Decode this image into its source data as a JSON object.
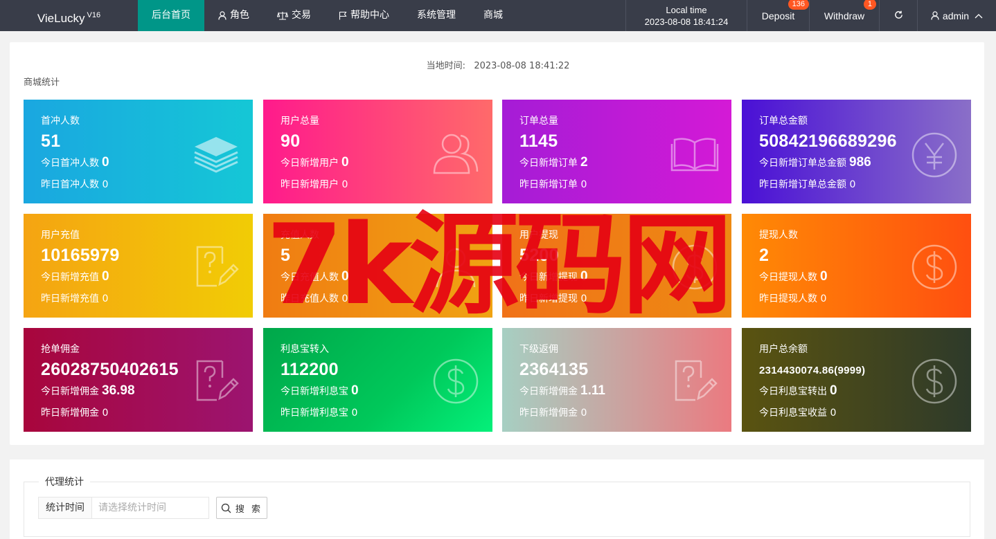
{
  "header": {
    "logo": "VieLucky",
    "logo_version": "V16",
    "nav": [
      {
        "label": "后台首页",
        "icon": "",
        "active": true
      },
      {
        "label": "角色",
        "icon": "user-icon"
      },
      {
        "label": "交易",
        "icon": "scale-icon"
      },
      {
        "label": "帮助中心",
        "icon": "flag-icon"
      },
      {
        "label": "系统管理",
        "icon": ""
      },
      {
        "label": "商城",
        "icon": ""
      }
    ],
    "local_time_label": "Local time",
    "local_time_value": "2023-08-08 18:41:24",
    "deposit_label": "Deposit",
    "deposit_badge": "136",
    "withdraw_label": "Withdraw",
    "withdraw_badge": "1",
    "user_label": "admin"
  },
  "dashboard": {
    "local_time_label": "当地时间:",
    "local_time_value": "2023-08-08 18:41:22",
    "section_title": "商城统计",
    "cards": [
      {
        "label": "首冲人数",
        "value": "51",
        "today_label": "今日首冲人数",
        "today_value": "0",
        "yesterday_label": "昨日首冲人数",
        "yesterday_value": "0",
        "icon": "layers-icon"
      },
      {
        "label": "用户总量",
        "value": "90",
        "today_label": "今日新增用户",
        "today_value": "0",
        "yesterday_label": "昨日新增用户",
        "yesterday_value": "0",
        "icon": "users-icon"
      },
      {
        "label": "订单总量",
        "value": "1145",
        "today_label": "今日新增订单",
        "today_value": "2",
        "yesterday_label": "昨日新增订单",
        "yesterday_value": "0",
        "icon": "book-icon"
      },
      {
        "label": "订单总金额",
        "value": "50842196689296",
        "today_label": "今日新增订单总金额",
        "today_value": "986",
        "yesterday_label": "昨日新增订单总金额",
        "yesterday_value": "0",
        "icon": "yen-icon"
      },
      {
        "label": "用户充值",
        "value": "10165979",
        "today_label": "今日新增充值",
        "today_value": "0",
        "yesterday_label": "昨日新增充值",
        "yesterday_value": "0",
        "icon": "edit-question-icon"
      },
      {
        "label": "充值人数",
        "value": "5",
        "today_label": "今日充值人数",
        "today_value": "0",
        "yesterday_label": "昨日充值人数",
        "yesterday_value": "0",
        "icon": "user-icon"
      },
      {
        "label": "用户提现",
        "value": "5200",
        "today_label": "今日新增提现",
        "today_value": "0",
        "yesterday_label": "昨日新增提现",
        "yesterday_value": "0",
        "icon": "dollar-icon"
      },
      {
        "label": "提现人数",
        "value": "2",
        "today_label": "今日提现人数",
        "today_value": "0",
        "yesterday_label": "昨日提现人数",
        "yesterday_value": "0",
        "icon": "dollar-icon"
      },
      {
        "label": "抢单佣金",
        "value": "26028750402615",
        "today_label": "今日新增佣金",
        "today_value": "36.98",
        "yesterday_label": "昨日新增佣金",
        "yesterday_value": "0",
        "icon": "edit-question-icon"
      },
      {
        "label": "利息宝转入",
        "value": "112200",
        "today_label": "今日新增利息宝",
        "today_value": "0",
        "yesterday_label": "昨日新增利息宝",
        "yesterday_value": "0",
        "icon": "dollar-icon"
      },
      {
        "label": "下级返佣",
        "value": "2364135",
        "today_label": "今日新增佣金",
        "today_value": "1.11",
        "yesterday_label": "昨日新增佣金",
        "yesterday_value": "0",
        "icon": "edit-question-icon"
      },
      {
        "label": "用户总余额",
        "value": "2314430074.86(9999)",
        "today_label": "今日利息宝转出",
        "today_value": "0",
        "yesterday_label": "今日利息宝收益",
        "yesterday_value": "0",
        "icon": "dollar-icon"
      }
    ],
    "watermark": "7k源码网"
  },
  "agent": {
    "legend": "代理统计",
    "time_label": "统计时间",
    "time_placeholder": "请选择统计时间",
    "search_label": "搜 索"
  }
}
